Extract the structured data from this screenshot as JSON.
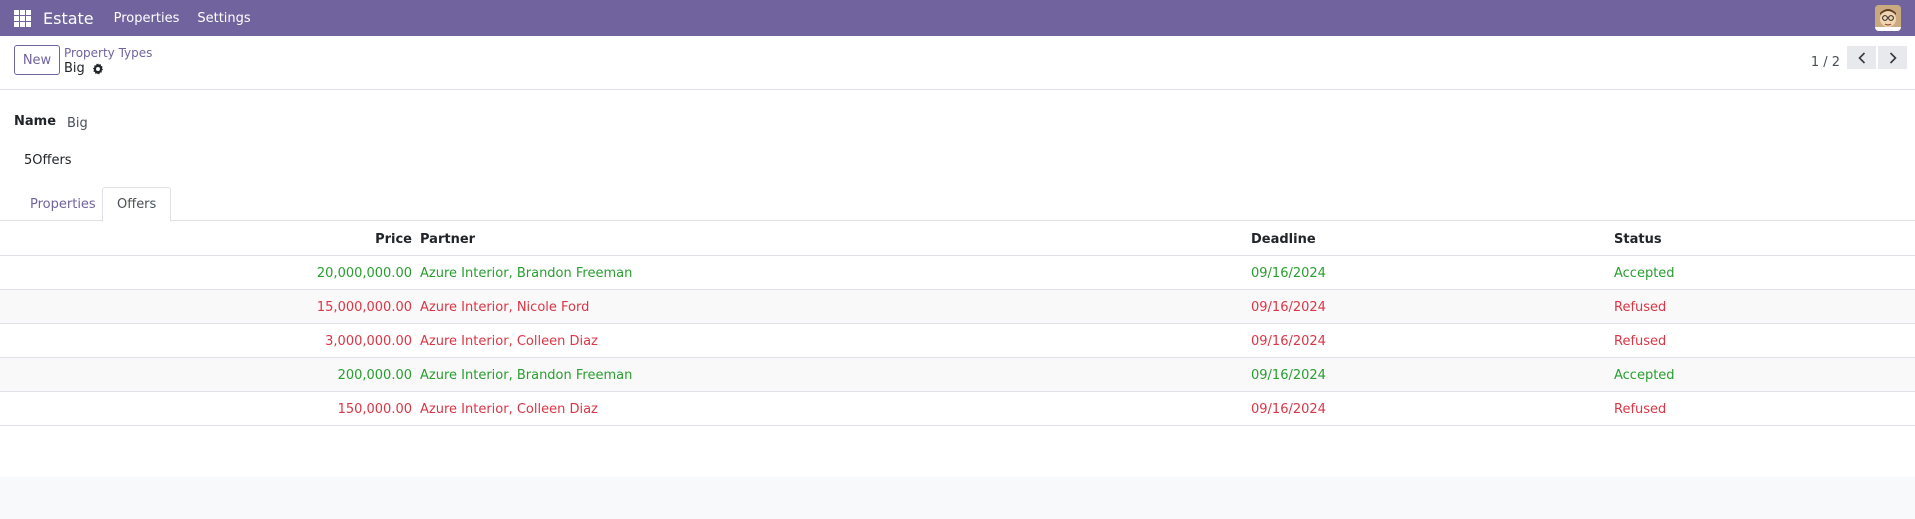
{
  "navbar": {
    "brand": "Estate",
    "menu": [
      "Properties",
      "Settings"
    ]
  },
  "control_panel": {
    "new_label": "New",
    "breadcrumb": "Property Types",
    "record_title": "Big",
    "pager_value": "1 / 2"
  },
  "form": {
    "name_label": "Name",
    "name_value": "Big",
    "offer_count": "5Offers"
  },
  "tabs": [
    "Properties",
    "Offers"
  ],
  "offers": {
    "columns": [
      "Price",
      "Partner",
      "Deadline",
      "Status"
    ],
    "rows": [
      {
        "price": "20,000,000.00",
        "partner": "Azure Interior, Brandon Freeman",
        "deadline": "09/16/2024",
        "status": "Accepted",
        "state": "accepted"
      },
      {
        "price": "15,000,000.00",
        "partner": "Azure Interior, Nicole Ford",
        "deadline": "09/16/2024",
        "status": "Refused",
        "state": "refused"
      },
      {
        "price": "3,000,000.00",
        "partner": "Azure Interior, Colleen Diaz",
        "deadline": "09/16/2024",
        "status": "Refused",
        "state": "refused"
      },
      {
        "price": "200,000.00",
        "partner": "Azure Interior, Brandon Freeman",
        "deadline": "09/16/2024",
        "status": "Accepted",
        "state": "accepted"
      },
      {
        "price": "150,000.00",
        "partner": "Azure Interior, Colleen Diaz",
        "deadline": "09/16/2024",
        "status": "Refused",
        "state": "refused"
      }
    ]
  },
  "colors": {
    "brand": "#71639e",
    "accepted": "#289e2f",
    "refused": "#dc3545"
  },
  "icons": {
    "apps": "grid-icon",
    "gear": "gear-icon",
    "prev": "chevron-left-icon",
    "next": "chevron-right-icon",
    "avatar": "user-avatar"
  }
}
